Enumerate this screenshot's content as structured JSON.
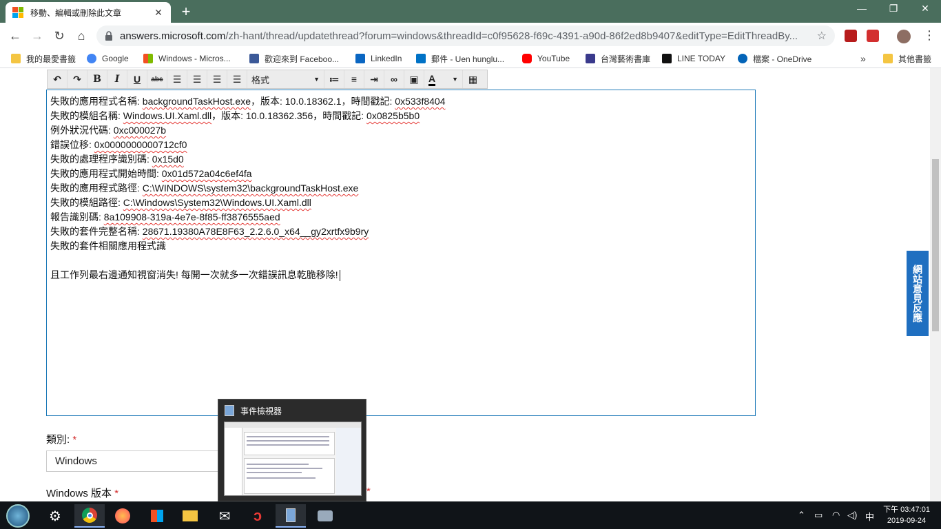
{
  "browser": {
    "tab_title": "移動、編輯或刪除此文章",
    "tab_close": "✕",
    "new_tab": "+",
    "window_controls": {
      "minimize": "—",
      "maximize": "❐",
      "close": "✕"
    },
    "url_host": "answers.microsoft.com",
    "url_rest": "/zh-hant/thread/updatethread?forum=windows&threadId=c0f95628-f69c-4391-a90d-86f2ed8b9407&editType=EditThreadBy...",
    "bookmarks": [
      {
        "label": "我的最愛書籤",
        "icon": "folder-icon",
        "color": "#f4c542"
      },
      {
        "label": "Google",
        "icon": "google-icon",
        "color": "#4285f4"
      },
      {
        "label": "Windows - Micros...",
        "icon": "windows-icon",
        "color": "#f25022"
      },
      {
        "label": "歡迎來到 Faceboo...",
        "icon": "facebook-icon",
        "color": "#3b5998"
      },
      {
        "label": "LinkedIn",
        "icon": "linkedin-icon",
        "color": "#0a66c2"
      },
      {
        "label": "郵件 - Uen hunglu...",
        "icon": "outlook-icon",
        "color": "#0072c6"
      },
      {
        "label": "YouTube",
        "icon": "youtube-icon",
        "color": "#ff0000"
      },
      {
        "label": "台灣藝術書庫",
        "icon": "bookmark-icon",
        "color": "#3a3a8c"
      },
      {
        "label": "LINE TODAY",
        "icon": "linetoday-icon",
        "color": "#111111"
      },
      {
        "label": "檔案 - OneDrive",
        "icon": "onedrive-icon",
        "color": "#0364b8"
      }
    ],
    "bookmarks_more": "»",
    "other_bookmarks": "其他書籤"
  },
  "editor": {
    "format_label": "格式",
    "lines": [
      {
        "label": "失敗的應用程式名稱: ",
        "value": "backgroundTaskHost.exe",
        "suffix": "，版本: 10.0.18362.1，時間戳記: ",
        "value2": "0x533f8404"
      },
      {
        "label": "失敗的模組名稱: ",
        "value": "Windows.UI.Xaml.dll",
        "suffix": "，版本: 10.0.18362.356，時間戳記: ",
        "value2": "0x0825b5b0"
      },
      {
        "label": "例外狀況代碼: ",
        "value": "0xc000027b",
        "suffix": "",
        "value2": ""
      },
      {
        "label": "錯誤位移: ",
        "value": "0x0000000000712cf0",
        "suffix": "",
        "value2": ""
      },
      {
        "label": "失敗的處理程序識別碼: ",
        "value": "0x15d0",
        "suffix": "",
        "value2": ""
      },
      {
        "label": "失敗的應用程式開始時間: ",
        "value": "0x01d572a04c6ef4fa",
        "suffix": "",
        "value2": ""
      },
      {
        "label": "失敗的應用程式路徑: ",
        "value": "C:\\WINDOWS\\system32\\backgroundTaskHost.exe",
        "suffix": "",
        "value2": ""
      },
      {
        "label": "失敗的模組路徑: ",
        "value": "C:\\Windows\\System32\\Windows.UI.Xaml.dll",
        "suffix": "",
        "value2": ""
      },
      {
        "label": "報告識別碼: ",
        "value": "8a109908-319a-4e7e-8f85-ff3876555aed",
        "suffix": "",
        "value2": ""
      },
      {
        "label": "失敗的套件完整名稱: ",
        "value": "28671.19380A78E8F63_2.2.6.0_x64__gy2xrtfx9b9ry",
        "suffix": "",
        "value2": ""
      },
      {
        "label": "失敗的套件相關應用程式識",
        "value": "",
        "suffix": "",
        "value2": ""
      }
    ],
    "closing_text": "且工作列最右邊通知視窗消失! 每開一次就多一次錯誤訊息乾脆移除!"
  },
  "form": {
    "category_label": "類別:",
    "category_value": "Windows",
    "version_label": "Windows 版本",
    "required_mark": "*"
  },
  "feedback_tab": "網站意見反應",
  "taskbar_popup": {
    "title": "事件檢視器"
  },
  "taskbar": {
    "ime": "中",
    "clock_time": "下午 03:47:01",
    "clock_date": "2019-09-24"
  }
}
